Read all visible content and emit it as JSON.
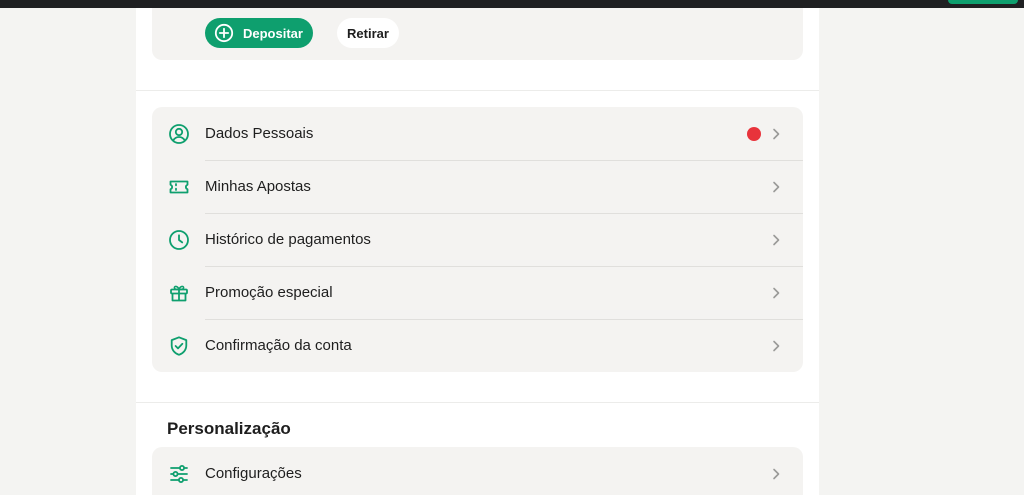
{
  "wallet": {
    "deposit_label": "Depositar",
    "withdraw_label": "Retirar"
  },
  "account_menu": [
    {
      "label": "Dados Pessoais",
      "icon": "user-circle-icon",
      "has_notification": true
    },
    {
      "label": "Minhas Apostas",
      "icon": "ticket-icon",
      "has_notification": false
    },
    {
      "label": "Histórico de pagamentos",
      "icon": "clock-icon",
      "has_notification": false
    },
    {
      "label": "Promoção especial",
      "icon": "gift-icon",
      "has_notification": false
    },
    {
      "label": "Confirmação da conta",
      "icon": "shield-check-icon",
      "has_notification": false
    }
  ],
  "personalization": {
    "title": "Personalização",
    "items": [
      {
        "label": "Configurações",
        "icon": "sliders-icon"
      }
    ]
  },
  "colors": {
    "accent": "#0e9f6e",
    "notification": "#e8333b",
    "card_bg": "#f4f3f1"
  }
}
